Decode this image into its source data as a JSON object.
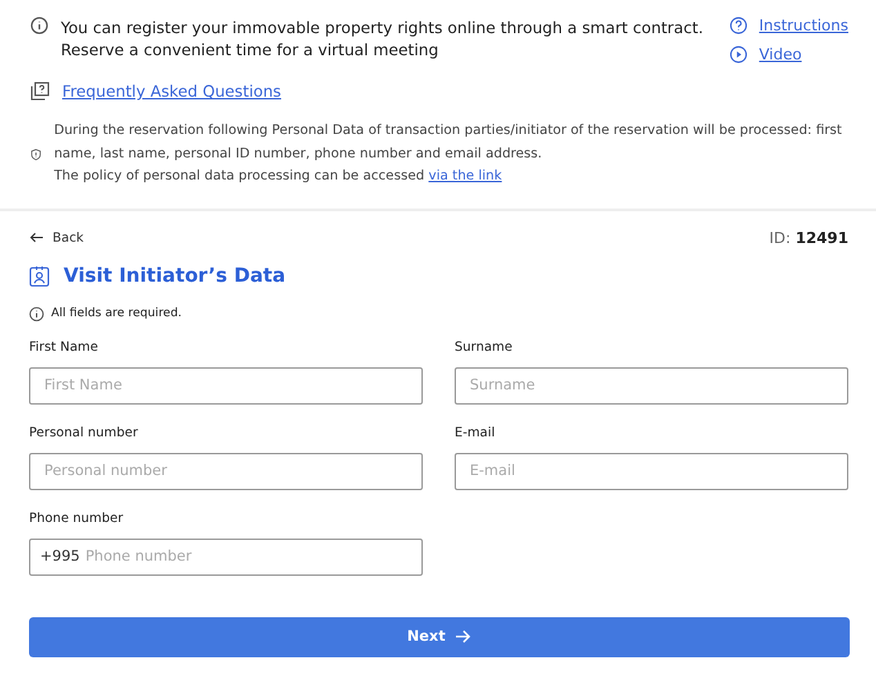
{
  "notice": {
    "lines": [
      "You can register your immovable property rights online through a smart contract.",
      "Reserve a convenient time for a virtual meeting"
    ]
  },
  "help_links": [
    {
      "kind": "question",
      "label": "Instructions"
    },
    {
      "kind": "play",
      "label": "Video"
    }
  ],
  "faq_link": "Frequently Asked Questions",
  "privacy": {
    "text": "During the reservation following Personal Data of transaction parties/initiator of the reservation will be processed: first name, last name, personal ID number, phone number and email address.",
    "policy_text": "The policy of personal data processing can be accessed",
    "link": "via the link"
  },
  "back": "Back",
  "id_label": "ID:",
  "id_value": "12491",
  "title": "Visit Initiator’s Data",
  "required_note": "All fields are required.",
  "fields": [
    {
      "kind": "text",
      "label": "First Name",
      "placeholder": "First Name"
    },
    {
      "kind": "text",
      "label": "Surname",
      "placeholder": "Surname"
    },
    {
      "kind": "text",
      "label": "Personal number",
      "placeholder": "Personal number"
    },
    {
      "kind": "text",
      "label": "E-mail",
      "placeholder": "E-mail"
    },
    {
      "kind": "phone",
      "label": "Phone number",
      "prefix": "+995",
      "placeholder": "Phone number"
    }
  ],
  "next_button": "Next"
}
